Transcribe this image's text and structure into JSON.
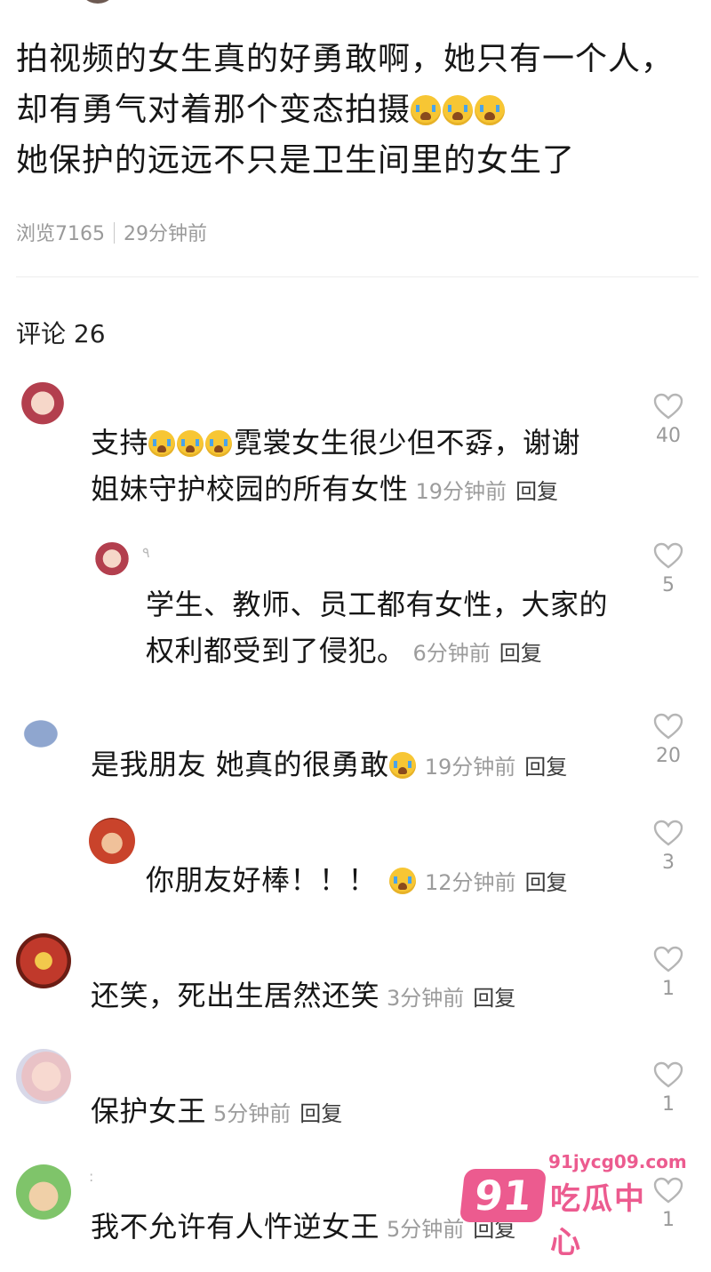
{
  "post": {
    "lines": [
      "拍视频的女生真的好勇敢啊，她只有一个人，",
      "却有勇气对着那个变态拍摄",
      "她保护的远远不只是卫生间里的女生了"
    ],
    "views": "浏览7165",
    "time": "29分钟前"
  },
  "comments_header": "评论 26",
  "comments": [
    {
      "avatar": "anime-girl-avatar",
      "line1": "支持",
      "line1b": "霓裳女生很少但不孬，谢谢",
      "line2": "姐妹守护校园的所有女性",
      "time": "19分钟前",
      "reply": "回复",
      "likes": "40"
    },
    {
      "avatar": "anime-girl-avatar",
      "username": "٩",
      "line1": "学生、教师、员工都有女性，大家的",
      "line2": "权利都受到了侵犯。",
      "time": "6分钟前",
      "reply": "回复",
      "likes": "5"
    },
    {
      "avatar": "fish-avatar",
      "line1": "是我朋友 她真的很勇敢",
      "time": "19分钟前",
      "reply": "回复",
      "likes": "20"
    },
    {
      "avatar": "red-hair-avatar",
      "line1": "你朋友好棒！！！",
      "time": "12分钟前",
      "reply": "回复",
      "likes": "3"
    },
    {
      "avatar": "iron-man-avatar",
      "line1": "还笑，死出生居然还笑",
      "time": "3分钟前",
      "reply": "回复",
      "likes": "1"
    },
    {
      "avatar": "girl-photo-avatar",
      "line1": "保护女王",
      "time": "5分钟前",
      "reply": "回复",
      "likes": "1"
    },
    {
      "avatar": "bear-avatar",
      "username": ":",
      "line1": "我不允许有人忤逆女王",
      "time": "5分钟前",
      "reply": "回复",
      "likes": "1"
    }
  ],
  "watermark": {
    "badge": "91",
    "site": "91jycg09.com",
    "name": "吃瓜中心",
    "color": "#ec5b8f"
  },
  "icons": {
    "emoji": "loudly-crying-face-emoji",
    "like": "heart-outline-icon"
  }
}
